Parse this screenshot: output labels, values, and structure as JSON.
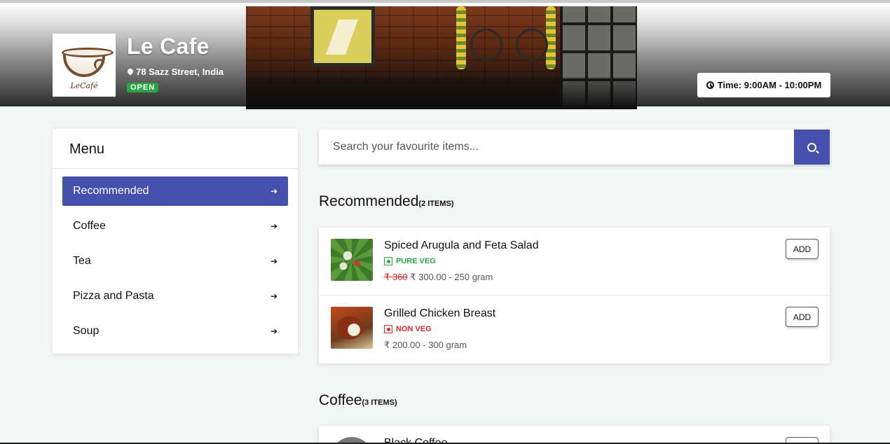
{
  "restaurant": {
    "name": "Le Cafe",
    "address": "78 Sazz Street, India",
    "status": "OPEN",
    "hours": "Time: 9:00AM - 10:00PM",
    "logo_text": "LeCafé"
  },
  "menu": {
    "title": "Menu",
    "items": [
      {
        "label": "Recommended",
        "active": true
      },
      {
        "label": "Coffee"
      },
      {
        "label": "Tea"
      },
      {
        "label": "Pizza and Pasta"
      },
      {
        "label": "Soup"
      }
    ]
  },
  "search": {
    "placeholder": "Search your favourite items..."
  },
  "sections": [
    {
      "title": "Recommended",
      "count": "(2 ITEMS)",
      "items": [
        {
          "name": "Spiced Arugula and Feta Salad",
          "type": "PURE VEG",
          "old_price": "₹ 360",
          "price": "₹ 300.00 - 250 gram",
          "button": "ADD"
        },
        {
          "name": "Grilled Chicken Breast",
          "type": "NON VEG",
          "price": "₹ 200.00 - 300 gram",
          "button": "ADD"
        }
      ]
    },
    {
      "title": "Coffee",
      "count": "(3 ITEMS)",
      "items": [
        {
          "name": "Black Coffee"
        }
      ]
    }
  ],
  "colors": {
    "accent": "#4550ad",
    "veg": "#28a745",
    "nonveg": "#e0282a"
  }
}
